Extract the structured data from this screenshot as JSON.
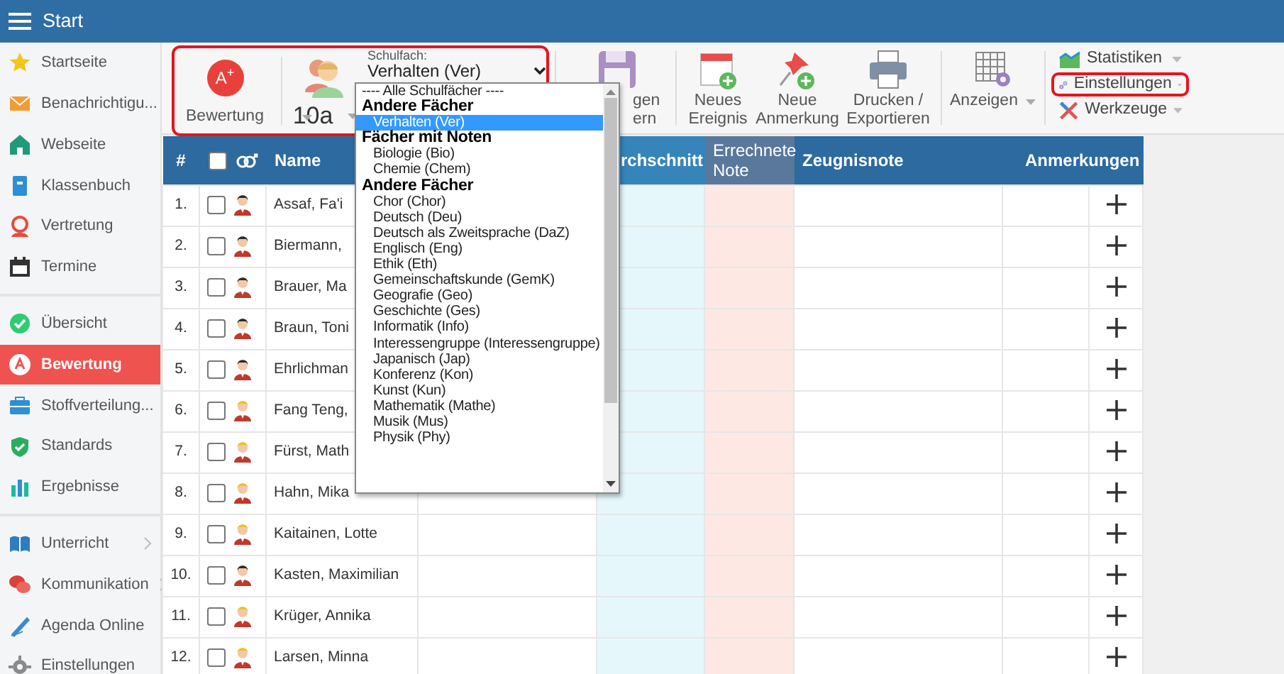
{
  "header": {
    "title": "Start"
  },
  "sidebar": {
    "sections": [
      [
        {
          "label": "Startseite",
          "selected": false
        },
        {
          "label": "Benachrichtigu...",
          "selected": false
        },
        {
          "label": "Webseite",
          "selected": false
        },
        {
          "label": "Klassenbuch",
          "selected": false
        },
        {
          "label": "Vertretung",
          "selected": false
        },
        {
          "label": "Termine",
          "selected": false
        }
      ],
      [
        {
          "label": "Übersicht",
          "selected": false
        },
        {
          "label": "Bewertung",
          "selected": true
        },
        {
          "label": "Stoffverteilung...",
          "selected": false
        },
        {
          "label": "Standards",
          "selected": false
        },
        {
          "label": "Ergebnisse",
          "selected": false
        }
      ],
      [
        {
          "label": "Unterricht",
          "selected": false,
          "expandable": true
        },
        {
          "label": "Kommunikation",
          "selected": false,
          "expandable": true
        },
        {
          "label": "Agenda Online",
          "selected": false,
          "expandable": false
        },
        {
          "label": "Einstellungen",
          "selected": false,
          "expandable": false
        }
      ]
    ]
  },
  "toolbar": {
    "primary_group": {
      "highlighted": true,
      "grade_menu": {
        "icon_text": "A$^{+}$",
        "label": "Bewertung"
      },
      "class_picker": {
        "label": "10a"
      },
      "subject_select": {
        "caption": "Schulfach:",
        "value": "Verhalten (Ver)",
        "expanded": true,
        "options": [
          {
            "kind": "option",
            "label": "---- Alle Schulfächer ----",
            "selected": false
          },
          {
            "kind": "group",
            "label": "Andere Fächer"
          },
          {
            "kind": "option",
            "label": "Verhalten (Ver)",
            "selected": true
          },
          {
            "kind": "group",
            "label": "Fächer mit Noten"
          },
          {
            "kind": "option",
            "label": "Biologie (Bio)",
            "selected": false
          },
          {
            "kind": "option",
            "label": "Chemie (Chem)",
            "selected": false
          },
          {
            "kind": "group",
            "label": "Andere Fächer"
          },
          {
            "kind": "option",
            "label": "Chor (Chor)",
            "selected": false
          },
          {
            "kind": "option",
            "label": "Deutsch (Deu)",
            "selected": false
          },
          {
            "kind": "option",
            "label": "Deutsch als Zweitsprache (DaZ)",
            "selected": false
          },
          {
            "kind": "option",
            "label": "Englisch (Eng)",
            "selected": false
          },
          {
            "kind": "option",
            "label": "Ethik (Eth)",
            "selected": false
          },
          {
            "kind": "option",
            "label": "Gemeinschaftskunde (GemK)",
            "selected": false
          },
          {
            "kind": "option",
            "label": "Geografie (Geo)",
            "selected": false
          },
          {
            "kind": "option",
            "label": "Geschichte (Ges)",
            "selected": false
          },
          {
            "kind": "option",
            "label": "Informatik (Info)",
            "selected": false
          },
          {
            "kind": "option",
            "label": "Interessengruppe (Interessengruppe)",
            "selected": false
          },
          {
            "kind": "option",
            "label": "Japanisch (Jap)",
            "selected": false
          },
          {
            "kind": "option",
            "label": "Konferenz (Kon)",
            "selected": false
          },
          {
            "kind": "option",
            "label": "Kunst (Kun)",
            "selected": false
          },
          {
            "kind": "option",
            "label": "Mathematik (Mathe)",
            "selected": false
          },
          {
            "kind": "option",
            "label": "Musik (Mus)",
            "selected": false
          },
          {
            "kind": "option",
            "label": "Physik (Phy)",
            "selected": false
          }
        ]
      }
    },
    "actions": [
      {
        "label_lines": [
          "gen",
          "ern"
        ]
      },
      {
        "label_lines": [
          "Neues",
          "Ereignis"
        ]
      },
      {
        "label_lines": [
          "Neue",
          "Anmerkung"
        ]
      },
      {
        "label_lines": [
          "Drucken /",
          "Exportieren"
        ]
      }
    ],
    "view_menu": {
      "label": "Anzeigen"
    },
    "side_menus": [
      {
        "label": "Statistiken",
        "highlighted": false
      },
      {
        "label": "Einstellungen",
        "highlighted": true
      },
      {
        "label": "Werkzeuge",
        "highlighted": false
      }
    ]
  },
  "table": {
    "columns": [
      "#",
      "Name",
      "rchschnitt",
      "Errechnete Note",
      "Zeugnisnote",
      "Anmerkungen"
    ],
    "select_all": {
      "checked": false
    },
    "rows": [
      {
        "number": "1.",
        "checked": false,
        "kind": "male",
        "name": "Assaf, Fa'i"
      },
      {
        "number": "2.",
        "checked": false,
        "kind": "male",
        "name": "Biermann,"
      },
      {
        "number": "3.",
        "checked": false,
        "kind": "male",
        "name": "Brauer, Ma"
      },
      {
        "number": "4.",
        "checked": false,
        "kind": "male",
        "name": "Braun, Toni"
      },
      {
        "number": "5.",
        "checked": false,
        "kind": "male",
        "name": "Ehrlichman"
      },
      {
        "number": "6.",
        "checked": false,
        "kind": "female",
        "name": "Fang Teng,"
      },
      {
        "number": "7.",
        "checked": false,
        "kind": "female",
        "name": "Fürst, Math"
      },
      {
        "number": "8.",
        "checked": false,
        "kind": "female",
        "name": "Hahn, Mika"
      },
      {
        "number": "9.",
        "checked": false,
        "kind": "female",
        "name": "Kaitainen, Lotte"
      },
      {
        "number": "10.",
        "checked": false,
        "kind": "male",
        "name": "Kasten, Maximilian"
      },
      {
        "number": "11.",
        "checked": false,
        "kind": "female",
        "name": "Krüger, Annika"
      },
      {
        "number": "12.",
        "checked": false,
        "kind": "female",
        "name": "Larsen, Minna"
      }
    ]
  }
}
